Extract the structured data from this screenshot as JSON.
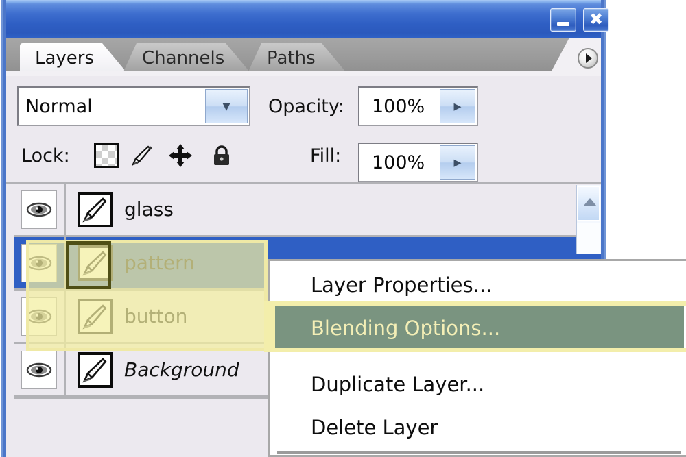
{
  "window": {
    "title": "",
    "minimize_label": "Minimize",
    "close_label": "✖"
  },
  "tabs": [
    {
      "label": "Layers",
      "active": true
    },
    {
      "label": "Channels",
      "active": false
    },
    {
      "label": "Paths",
      "active": false
    }
  ],
  "panel_menu": {
    "icon": "panel-menu-triangle-icon"
  },
  "blend_row": {
    "mode_value": "Normal",
    "mode_dropdown_icon": "▾",
    "opacity_label": "Opacity:",
    "opacity_value": "100%",
    "opacity_spin_icon": "▸"
  },
  "lock_row": {
    "lock_label": "Lock:",
    "icons": [
      {
        "name": "lock-transparent-pixels-icon",
        "title": "Lock transparent pixels"
      },
      {
        "name": "lock-image-pixels-icon",
        "title": "Lock image pixels"
      },
      {
        "name": "lock-position-icon",
        "title": "Lock position"
      },
      {
        "name": "lock-all-icon",
        "title": "Lock all"
      }
    ],
    "fill_label": "Fill:",
    "fill_value": "100%",
    "fill_spin_icon": "▸"
  },
  "layers": [
    {
      "name": "glass",
      "visible": true,
      "selected": false,
      "italic": false
    },
    {
      "name": "pattern",
      "visible": true,
      "selected": true,
      "italic": false
    },
    {
      "name": "button",
      "visible": true,
      "selected": false,
      "italic": false
    },
    {
      "name": "Background",
      "visible": true,
      "selected": false,
      "italic": true
    }
  ],
  "scrollbar": {
    "up_arrow_icon": "scroll-up-arrow-icon"
  },
  "context_menu": {
    "items": [
      {
        "label": "Layer Properties...",
        "highlighted": false
      },
      {
        "label": "Blending Options...",
        "highlighted": true
      },
      {
        "label": "Duplicate Layer...",
        "highlighted": false
      },
      {
        "label": "Delete Layer",
        "highlighted": false
      }
    ]
  },
  "colors": {
    "titlebar_blue": "#2f5fc4",
    "panel_bg": "#ece9ef",
    "selection_blue": "#2f5fc4",
    "highlight_green": "#7a9480",
    "highlight_text": "#f4efb6",
    "annotation_yellow": "#f3eeab",
    "annotation_dark": "#4f4f16"
  }
}
